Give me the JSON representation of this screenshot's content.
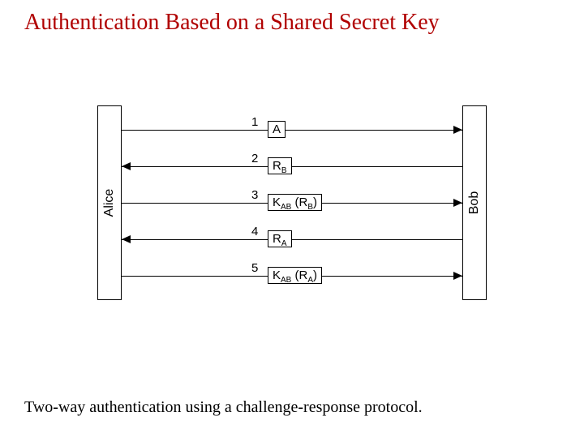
{
  "title": "Authentication Based on a Shared Secret Key",
  "caption": "Two-way authentication using a challenge-response protocol.",
  "parties": {
    "left": "Alice",
    "right": "Bob"
  },
  "chart_data": {
    "type": "sequence",
    "participants": [
      "Alice",
      "Bob"
    ],
    "messages": [
      {
        "step": "1",
        "from": "Alice",
        "to": "Bob",
        "label_plain": "A",
        "label_html": "A"
      },
      {
        "step": "2",
        "from": "Bob",
        "to": "Alice",
        "label_plain": "RB",
        "label_html": "R<span class=\"sub\">B</span>"
      },
      {
        "step": "3",
        "from": "Alice",
        "to": "Bob",
        "label_plain": "KAB (RB)",
        "label_html": "K<span class=\"sub\">AB</span> (R<span class=\"sub\">B</span>)"
      },
      {
        "step": "4",
        "from": "Bob",
        "to": "Alice",
        "label_plain": "RA",
        "label_html": "R<span class=\"sub\">A</span>"
      },
      {
        "step": "5",
        "from": "Alice",
        "to": "Bob",
        "label_plain": "KAB (RA)",
        "label_html": "K<span class=\"sub\">AB</span> (R<span class=\"sub\">A</span>)"
      }
    ]
  }
}
